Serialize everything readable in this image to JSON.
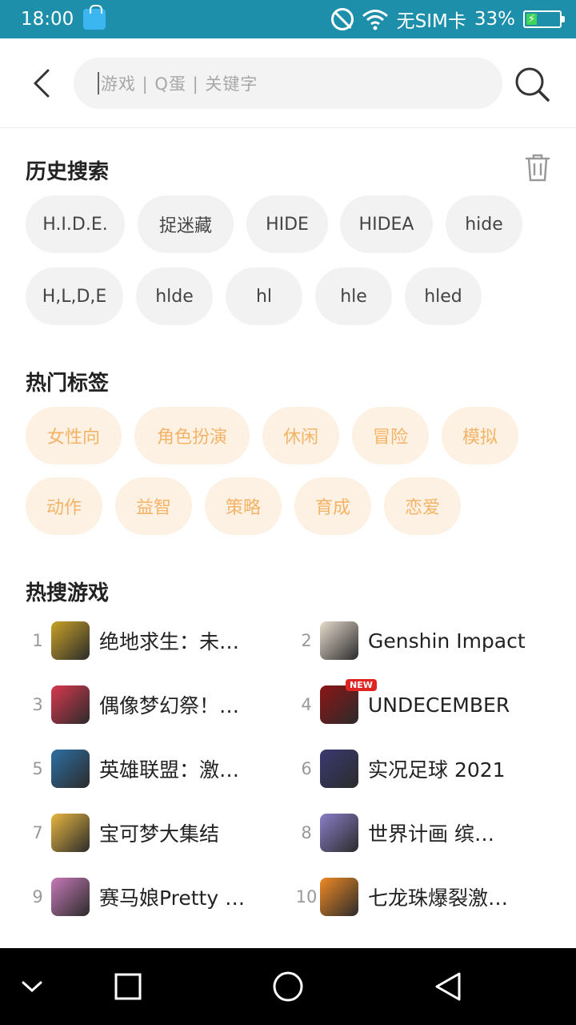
{
  "status": {
    "time": "18:00",
    "carrier": "无SIM卡",
    "battery": "33%",
    "battery_level": 0.33
  },
  "search": {
    "placeholder": "游戏 | Q蛋 | 关键字"
  },
  "history": {
    "title": "历史搜索",
    "items": [
      "H.I.D.E.",
      "捉迷藏",
      "HIDE",
      "HIDEA",
      "hide",
      "H,L,D,E",
      "hlde",
      "hl",
      "hle",
      "hled"
    ]
  },
  "tags": {
    "title": "热门标签",
    "items": [
      "女性向",
      "角色扮演",
      "休闲",
      "冒险",
      "模拟",
      "动作",
      "益智",
      "策略",
      "育成",
      "恋爱"
    ]
  },
  "hot": {
    "title": "热搜游戏",
    "games": [
      {
        "rank": "1",
        "name": "绝地求生：未…",
        "color": "#c9a227"
      },
      {
        "rank": "2",
        "name": "Genshin Impact",
        "color": "#e8dccd"
      },
      {
        "rank": "3",
        "name": "偶像梦幻祭！…",
        "color": "#d9384f"
      },
      {
        "rank": "4",
        "name": "UNDECEMBER",
        "color": "#8c1515",
        "badge": "NEW"
      },
      {
        "rank": "5",
        "name": "英雄联盟：激…",
        "color": "#2d6fa3"
      },
      {
        "rank": "6",
        "name": "实况足球 2021",
        "color": "#3a3a72"
      },
      {
        "rank": "7",
        "name": "宝可梦大集结",
        "color": "#e8b640"
      },
      {
        "rank": "8",
        "name": "世界计画 缤…",
        "color": "#8a7ec8"
      },
      {
        "rank": "9",
        "name": "赛马娘Pretty …",
        "color": "#c77ab8"
      },
      {
        "rank": "10",
        "name": "七龙珠爆裂激…",
        "color": "#f08a24"
      }
    ]
  }
}
